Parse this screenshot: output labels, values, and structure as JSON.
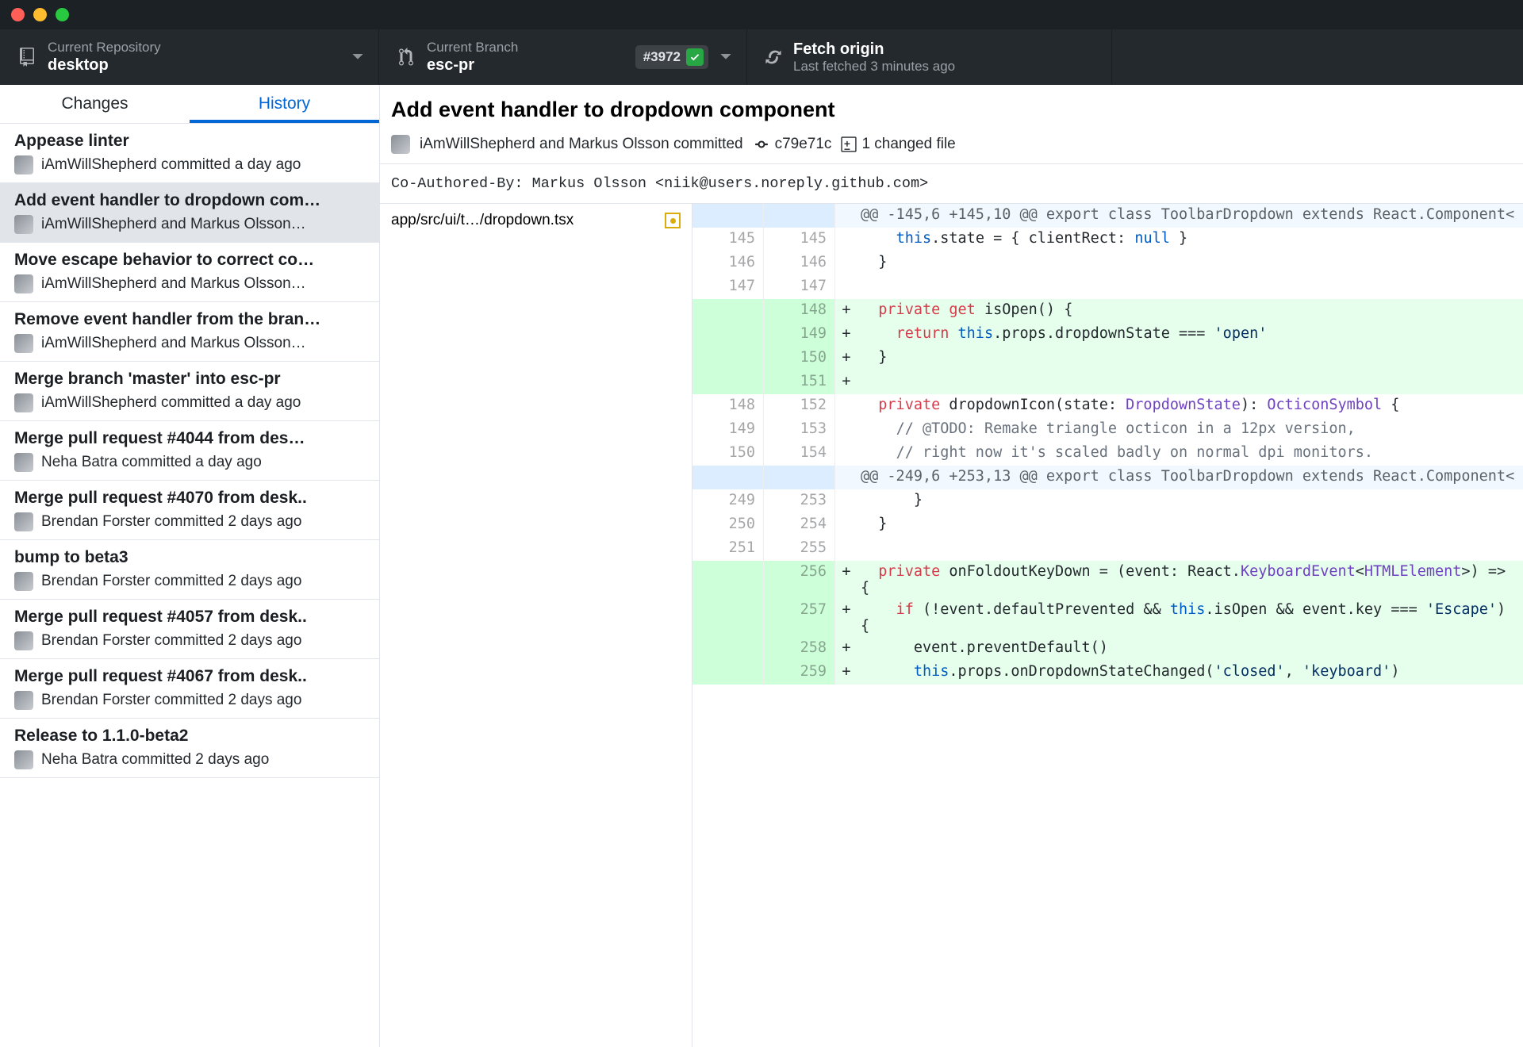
{
  "window": {
    "title": ""
  },
  "toolbar": {
    "repo": {
      "label": "Current Repository",
      "value": "desktop"
    },
    "branch": {
      "label": "Current Branch",
      "value": "esc-pr",
      "pr_badge": "#3972"
    },
    "fetch": {
      "label": "Fetch origin",
      "sub": "Last fetched 3 minutes ago"
    }
  },
  "tabs": {
    "changes": "Changes",
    "history": "History"
  },
  "commits": [
    {
      "title": "Appease linter",
      "meta": "iAmWillShepherd committed a day ago"
    },
    {
      "title": "Add event handler to dropdown com…",
      "meta": "iAmWillShepherd and Markus Olsson…"
    },
    {
      "title": "Move escape behavior to correct co…",
      "meta": "iAmWillShepherd and Markus Olsson…"
    },
    {
      "title": "Remove event handler from the bran…",
      "meta": "iAmWillShepherd and Markus Olsson…"
    },
    {
      "title": "Merge branch 'master' into esc-pr",
      "meta": "iAmWillShepherd committed a day ago"
    },
    {
      "title": "Merge pull request #4044 from des…",
      "meta": "Neha Batra committed a day ago"
    },
    {
      "title": "Merge pull request #4070 from desk..",
      "meta": "Brendan Forster committed 2 days ago"
    },
    {
      "title": "bump to beta3",
      "meta": "Brendan Forster committed 2 days ago"
    },
    {
      "title": "Merge pull request #4057 from desk..",
      "meta": "Brendan Forster committed 2 days ago"
    },
    {
      "title": "Merge pull request #4067 from desk..",
      "meta": "Brendan Forster committed 2 days ago"
    },
    {
      "title": "Release to 1.1.0-beta2",
      "meta": "Neha Batra committed 2 days ago"
    }
  ],
  "selected_commit_index": 1,
  "detail": {
    "title": "Add event handler to dropdown component",
    "authors": "iAmWillShepherd and Markus Olsson committed",
    "sha": "c79e71c",
    "files_label": "1 changed file",
    "body": "Co-Authored-By: Markus Olsson <niik@users.noreply.github.com>",
    "file": "app/src/ui/t…/dropdown.tsx"
  },
  "diff": [
    {
      "type": "hunk",
      "a": "",
      "b": "",
      "text": "@@ -145,6 +145,10 @@ export class ToolbarDropdown extends React.Component<"
    },
    {
      "type": "ctx",
      "a": "145",
      "b": "145",
      "tokens": [
        [
          "    ",
          ""
        ],
        [
          "this",
          "this"
        ],
        [
          ".state = { clientRect: ",
          ""
        ],
        [
          "null",
          "null"
        ],
        [
          " }",
          ""
        ]
      ]
    },
    {
      "type": "ctx",
      "a": "146",
      "b": "146",
      "tokens": [
        [
          "  }",
          ""
        ]
      ]
    },
    {
      "type": "ctx",
      "a": "147",
      "b": "147",
      "tokens": [
        [
          "",
          ""
        ]
      ]
    },
    {
      "type": "add",
      "a": "",
      "b": "148",
      "tokens": [
        [
          "  ",
          ""
        ],
        [
          "private",
          "keyword"
        ],
        [
          " ",
          ""
        ],
        [
          "get",
          "keyword"
        ],
        [
          " isOpen() {",
          ""
        ]
      ]
    },
    {
      "type": "add",
      "a": "",
      "b": "149",
      "tokens": [
        [
          "    ",
          ""
        ],
        [
          "return",
          "keyword"
        ],
        [
          " ",
          ""
        ],
        [
          "this",
          "this"
        ],
        [
          ".props.dropdownState === ",
          ""
        ],
        [
          "'open'",
          "string"
        ]
      ]
    },
    {
      "type": "add",
      "a": "",
      "b": "150",
      "tokens": [
        [
          "  }",
          ""
        ]
      ]
    },
    {
      "type": "add",
      "a": "",
      "b": "151",
      "tokens": [
        [
          "",
          ""
        ]
      ]
    },
    {
      "type": "ctx",
      "a": "148",
      "b": "152",
      "tokens": [
        [
          "  ",
          ""
        ],
        [
          "private",
          "keyword"
        ],
        [
          " dropdownIcon(state: ",
          ""
        ],
        [
          "DropdownState",
          "type"
        ],
        [
          "): ",
          ""
        ],
        [
          "OcticonSymbol",
          "type"
        ],
        [
          " {",
          ""
        ]
      ]
    },
    {
      "type": "ctx",
      "a": "149",
      "b": "153",
      "tokens": [
        [
          "    ",
          ""
        ],
        [
          "// @TODO: Remake triangle octicon in a 12px version,",
          "comment"
        ]
      ]
    },
    {
      "type": "ctx",
      "a": "150",
      "b": "154",
      "tokens": [
        [
          "    ",
          ""
        ],
        [
          "// right now it's scaled badly on normal dpi monitors.",
          "comment"
        ]
      ]
    },
    {
      "type": "hunk",
      "a": "",
      "b": "",
      "text": "@@ -249,6 +253,13 @@ export class ToolbarDropdown extends React.Component<"
    },
    {
      "type": "ctx",
      "a": "249",
      "b": "253",
      "tokens": [
        [
          "      }",
          ""
        ]
      ]
    },
    {
      "type": "ctx",
      "a": "250",
      "b": "254",
      "tokens": [
        [
          "  }",
          ""
        ]
      ]
    },
    {
      "type": "ctx",
      "a": "251",
      "b": "255",
      "tokens": [
        [
          "",
          ""
        ]
      ]
    },
    {
      "type": "add",
      "a": "",
      "b": "256",
      "tokens": [
        [
          "  ",
          ""
        ],
        [
          "private",
          "keyword"
        ],
        [
          " onFoldoutKeyDown = (event: React.",
          ""
        ],
        [
          "KeyboardEvent",
          "type"
        ],
        [
          "<",
          ""
        ],
        [
          "HTMLElement",
          "type"
        ],
        [
          ">) => {",
          ""
        ]
      ]
    },
    {
      "type": "add",
      "a": "",
      "b": "257",
      "tokens": [
        [
          "    ",
          ""
        ],
        [
          "if",
          "keyword"
        ],
        [
          " (!event.defaultPrevented && ",
          ""
        ],
        [
          "this",
          "this"
        ],
        [
          ".isOpen && event.key === ",
          ""
        ],
        [
          "'Escape'",
          "string"
        ],
        [
          ") {",
          ""
        ]
      ]
    },
    {
      "type": "add",
      "a": "",
      "b": "258",
      "tokens": [
        [
          "      event.preventDefault()",
          ""
        ]
      ]
    },
    {
      "type": "add",
      "a": "",
      "b": "259",
      "tokens": [
        [
          "      ",
          ""
        ],
        [
          "this",
          "this"
        ],
        [
          ".props.onDropdownStateChanged(",
          ""
        ],
        [
          "'closed'",
          "string"
        ],
        [
          ", ",
          ""
        ],
        [
          "'keyboard'",
          "string"
        ],
        [
          ")",
          ""
        ]
      ]
    }
  ]
}
